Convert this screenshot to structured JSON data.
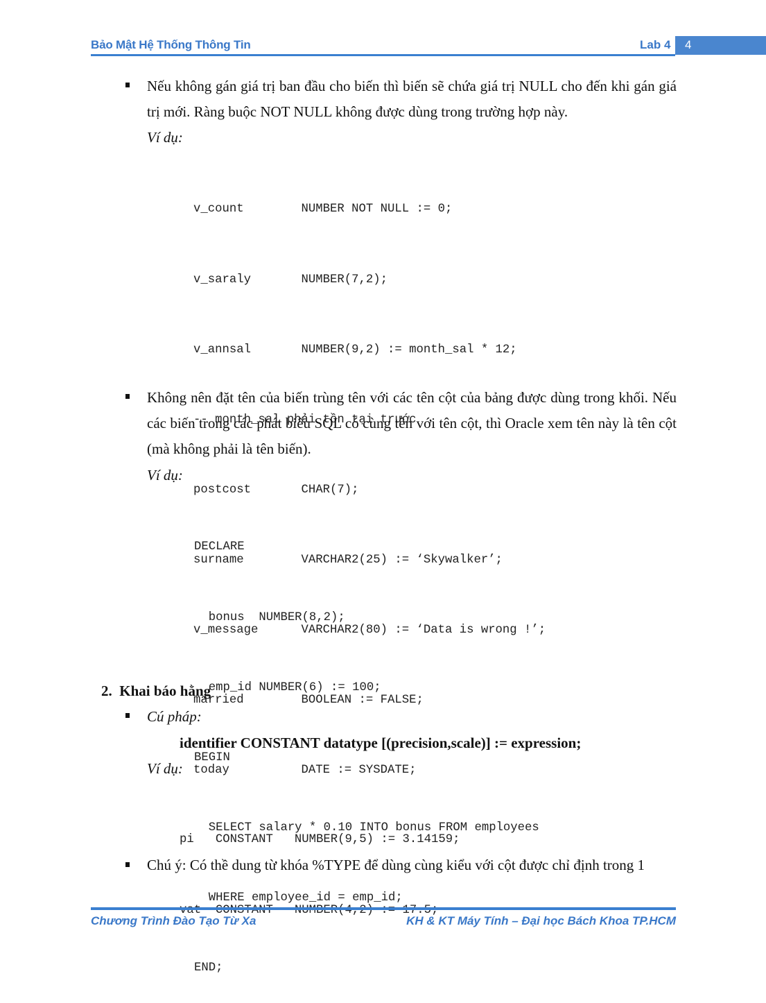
{
  "header": {
    "title": "Bảo Mật Hệ Thống Thông Tin",
    "lab": "Lab 4",
    "page_number": "4"
  },
  "section1": {
    "bullet1": "Nếu không gán giá trị ban đầu cho biến thì biến sẽ chứa giá trị NULL cho đến khi gán giá trị mới. Ràng buộc NOT NULL không được dùng trong trường hợp này.",
    "example_label": "Ví dụ:",
    "code1": [
      "v_count        NUMBER NOT NULL := 0;",
      "v_saraly       NUMBER(7,2);",
      "v_annsal       NUMBER(9,2) := month_sal * 12;",
      "-- month_sal phải tồn tại trước",
      "postcost       CHAR(7);",
      "surname        VARCHAR2(25) := ‘Skywalker’;",
      "v_message      VARCHAR2(80) := ‘Data is wrong !’;",
      "married        BOOLEAN := FALSE;",
      "today          DATE := SYSDATE;"
    ],
    "bullet2": "Không nên đặt tên của biến trùng tên với các tên cột của bảng được dùng trong khối. Nếu các biến trong các phát biểu SQL có cùng tên với tên cột, thì Oracle xem tên này là tên cột (mà không phải là tên biến).",
    "example_label2": "Ví dụ:",
    "code2": [
      "DECLARE",
      "  bonus  NUMBER(8,2);",
      "  emp_id NUMBER(6) := 100;",
      "BEGIN",
      "  SELECT salary * 0.10 INTO bonus FROM employees",
      "  WHERE employee_id = emp_id;",
      "END;"
    ]
  },
  "section2": {
    "heading": "2.  Khai báo hằng",
    "syntax_label": "Cú pháp:",
    "syntax": "identifier CONSTANT datatype [(precision,scale)] := expression;",
    "example_label": "Ví dụ:",
    "code": [
      "pi   CONSTANT   NUMBER(9,5) := 3.14159;",
      "vat  CONSTANT   NUMBER(4,2) := 17.5;"
    ],
    "note": "Chú ý: Có thề dung từ khóa %TYPE để dùng cùng kiểu với cột được chỉ định trong 1"
  },
  "footer": {
    "left": "Chương Trình Đào Tạo Từ Xa",
    "right": "KH & KT Máy Tính – Đại học Bách Khoa TP.HCM"
  }
}
